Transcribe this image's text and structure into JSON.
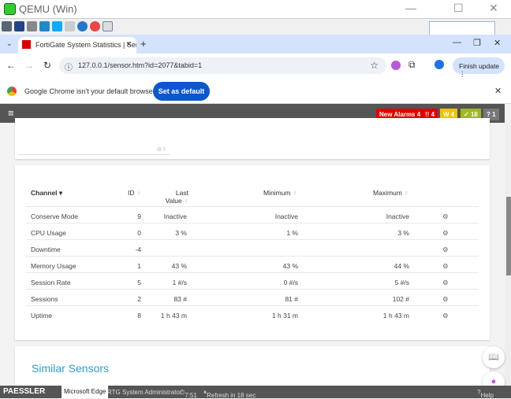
{
  "qemu": {
    "title": "QEMU (Win)"
  },
  "browser": {
    "tab_title": "FortiGate System Statistics | Sen",
    "url": "127.0.0.1/sensor.htm?id=2077&tabid=1",
    "finish_update": "Finish update"
  },
  "infobar": {
    "message": "Google Chrome isn't your default browser",
    "button": "Set as default"
  },
  "prtg": {
    "badges": [
      {
        "label": "New Alarms",
        "count": "4",
        "color": "#e10000"
      },
      {
        "label": "!!",
        "count": "4",
        "color": "#e10000"
      },
      {
        "label": "W",
        "count": "4",
        "color": "#f0c400"
      },
      {
        "label": "✓",
        "count": "18",
        "color": "#9fb91f"
      },
      {
        "label": "?",
        "count": "1",
        "color": "#777"
      }
    ]
  },
  "table": {
    "headers": {
      "channel": "Channel",
      "id": "ID",
      "last": "Last",
      "last2": "Value",
      "min": "Minimum",
      "max": "Maximum"
    },
    "rows": [
      {
        "channel": "Conserve Mode",
        "id": "9",
        "last": "Inactive",
        "min": "Inactive",
        "max": "Inactive"
      },
      {
        "channel": "CPU Usage",
        "id": "0",
        "last": "3 %",
        "min": "1 %",
        "max": "3 %"
      },
      {
        "channel": "Downtime",
        "id": "-4",
        "last": "",
        "min": "",
        "max": ""
      },
      {
        "channel": "Memory Usage",
        "id": "1",
        "last": "43 %",
        "min": "43 %",
        "max": "44 %"
      },
      {
        "channel": "Session Rate",
        "id": "5",
        "last": "1 #/s",
        "min": "0 #/s",
        "max": "5 #/s"
      },
      {
        "channel": "Sessions",
        "id": "2",
        "last": "83 #",
        "min": "81 #",
        "max": "102 #"
      },
      {
        "channel": "Uptime",
        "id": "8",
        "last": "1 h 43 m",
        "min": "1 h 31 m",
        "max": "1 h 43 m"
      }
    ]
  },
  "similar": {
    "title": "Similar Sensors"
  },
  "footer": {
    "brand": "PAESSLER",
    "tooltip": "Microsoft Edge",
    "user": "RTG System Administrator",
    "time": "7:51",
    "refresh": "Refresh in 18 sec",
    "help": "Help"
  }
}
